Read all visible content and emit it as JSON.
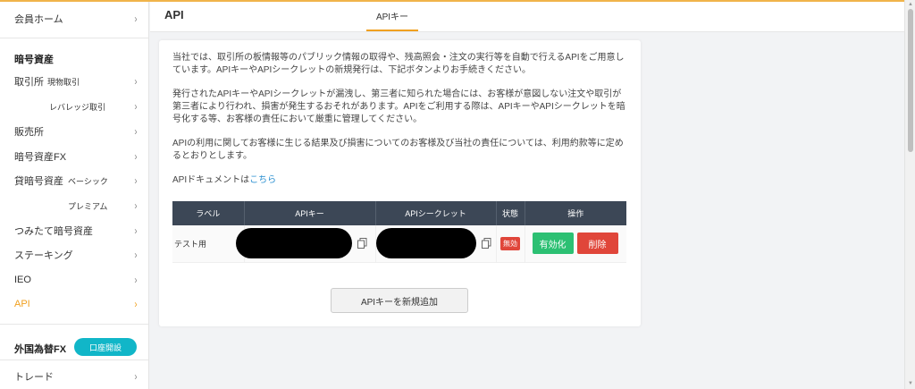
{
  "sidebar": {
    "member_home": "会員ホーム",
    "crypto_section": "暗号資産",
    "exchange": "取引所",
    "exchange_spot": "現物取引",
    "exchange_leverage": "レバレッジ取引",
    "sales": "販売所",
    "crypto_fx": "暗号資産FX",
    "lending": "貸暗号資産",
    "lending_basic": "ベーシック",
    "lending_premium": "プレミアム",
    "tsumitate": "つみたて暗号資産",
    "staking": "ステーキング",
    "ieo": "IEO",
    "api": "API",
    "fx_section": "外国為替FX",
    "open_account": "口座開設",
    "trade": "トレード",
    "chevron": "›"
  },
  "header": {
    "title": "API",
    "tab": "APIキー"
  },
  "content": {
    "para1": "当社では、取引所の板情報等のパブリック情報の取得や、残高照会・注文の実行等を自動で行えるAPIをご用意しています。APIキーやAPIシークレットの新規発行は、下記ボタンよりお手続きください。",
    "para2": "発行されたAPIキーやAPIシークレットが漏洩し、第三者に知られた場合には、お客様が意図しない注文や取引が第三者により行われ、損害が発生するおそれがあります。APIをご利用する際は、APIキーやAPIシークレットを暗号化する等、お客様の責任において厳重に管理してください。",
    "para3": "APIの利用に関してお客様に生じる結果及び損害についてのお客様及び当社の責任については、利用約款等に定めるとおりとします。",
    "doc_prefix": "APIドキュメントは",
    "doc_link": "こちら",
    "add_button": "APIキーを新規追加"
  },
  "table": {
    "headers": [
      "ラベル",
      "APIキー",
      "APIシークレット",
      "状態",
      "操作"
    ],
    "rows": [
      {
        "label": "テスト用",
        "status": "無効",
        "enable": "有効化",
        "delete": "削除"
      }
    ]
  },
  "colors": {
    "accent": "#f0a020",
    "table_header": "#3c4756",
    "enable": "#2cc073",
    "delete": "#e0463a",
    "open_account": "#11b6c8",
    "link": "#2a8fd0"
  }
}
